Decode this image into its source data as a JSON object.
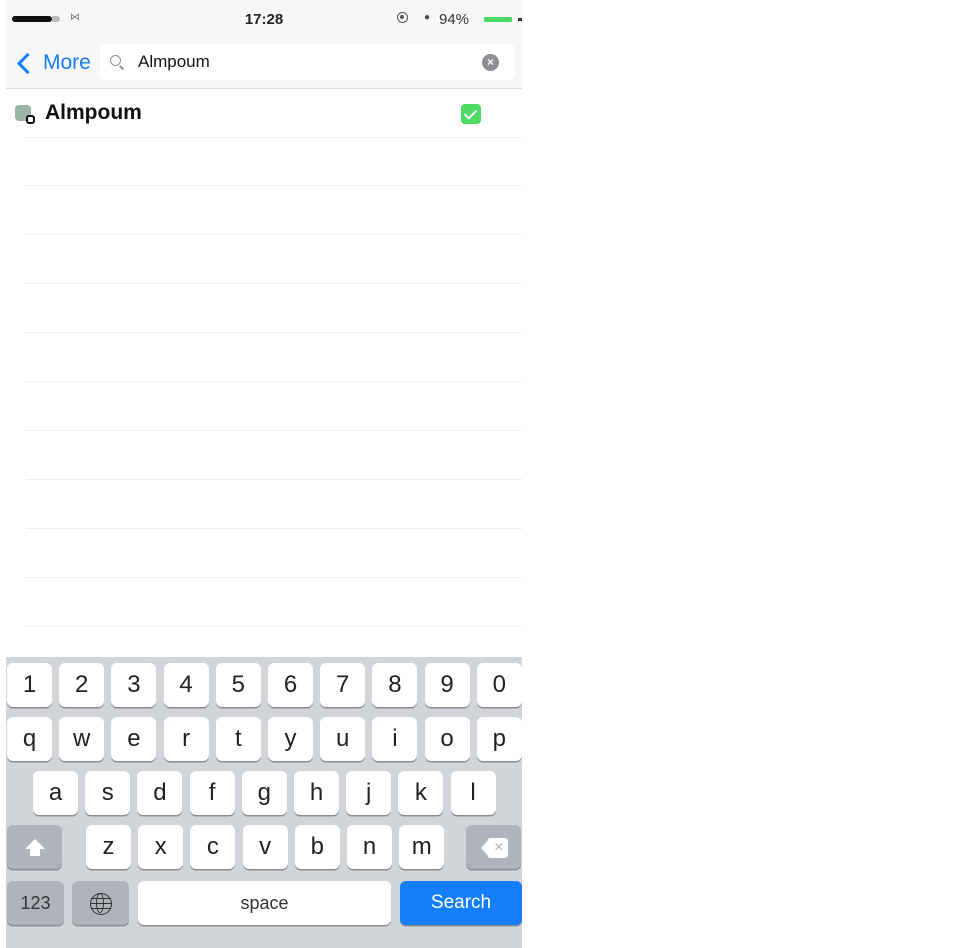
{
  "status_bar": {
    "time": "17:28",
    "battery_percent": "94%",
    "carrier_icon": "carrier-glyph",
    "icons": [
      "signal-icon",
      "rotation-lock-icon",
      "location-icon",
      "battery-icon"
    ]
  },
  "nav": {
    "back_label": "More",
    "search": {
      "value": "Almpoum",
      "placeholder": ""
    },
    "clear_icon": "×"
  },
  "results": [
    {
      "title": "Almpoum",
      "checked": true
    }
  ],
  "empty_rows": 10,
  "keyboard": {
    "number_row": [
      "1",
      "2",
      "3",
      "4",
      "5",
      "6",
      "7",
      "8",
      "9",
      "0"
    ],
    "top_row": [
      "q",
      "w",
      "e",
      "r",
      "t",
      "y",
      "u",
      "i",
      "o",
      "p"
    ],
    "middle_row": [
      "a",
      "s",
      "d",
      "f",
      "g",
      "h",
      "j",
      "k",
      "l"
    ],
    "bottom_row": [
      "z",
      "x",
      "c",
      "v",
      "b",
      "n",
      "m"
    ],
    "numbers_label": "123",
    "space_label": "space",
    "search_label": "Search",
    "delete_glyph": "×"
  },
  "colors": {
    "accent": "#147efb",
    "check_green": "#4cd964",
    "battery_green": "#4cd964"
  }
}
